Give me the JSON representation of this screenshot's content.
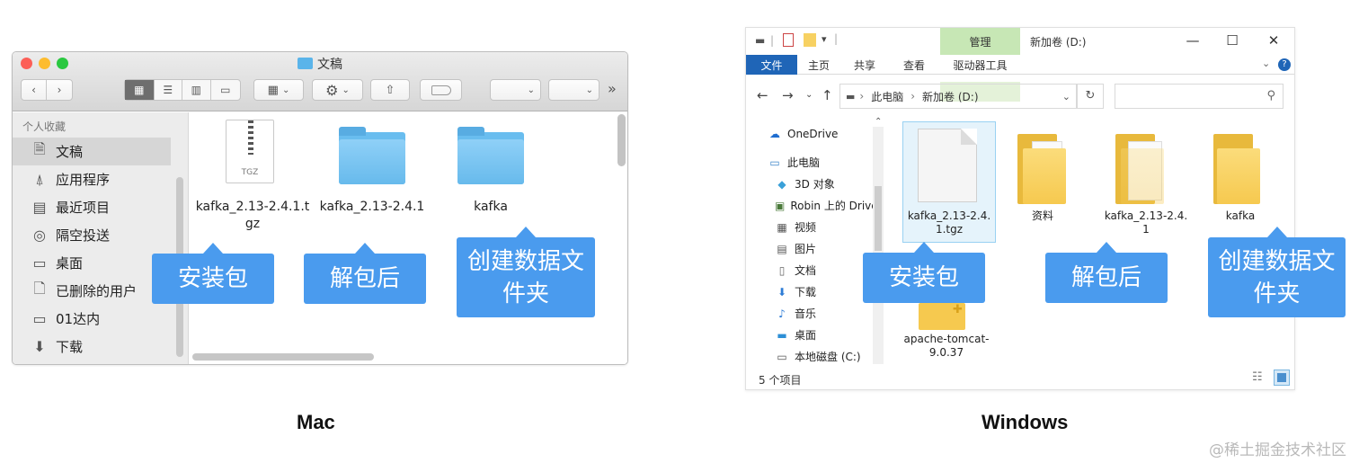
{
  "mac": {
    "window_title": "文稿",
    "sidebar_section": "个人收藏",
    "sidebar_items": [
      {
        "label": "文稿",
        "icon": "documents-icon"
      },
      {
        "label": "应用程序",
        "icon": "applications-icon"
      },
      {
        "label": "最近项目",
        "icon": "recents-icon"
      },
      {
        "label": "隔空投送",
        "icon": "airdrop-icon"
      },
      {
        "label": "桌面",
        "icon": "desktop-icon"
      },
      {
        "label": "已删除的用户",
        "icon": "document-icon"
      },
      {
        "label": "01达内",
        "icon": "folder-icon"
      },
      {
        "label": "下载",
        "icon": "download-icon"
      }
    ],
    "files": [
      {
        "name_line1": "kafka_2.13-2.4.1.t",
        "name_line2": "gz",
        "type": "archive",
        "badge": "TGZ"
      },
      {
        "name_line1": "kafka_2.13-2.4.1",
        "name_line2": "",
        "type": "folder"
      },
      {
        "name_line1": "kafka",
        "name_line2": "",
        "type": "folder"
      }
    ],
    "caption": "Mac"
  },
  "windows": {
    "ribbon": {
      "manage": "管理",
      "drive_title": "新加卷 (D:)",
      "tabs": [
        "文件",
        "主页",
        "共享",
        "查看",
        "驱动器工具"
      ]
    },
    "address": {
      "crumb1": "此电脑",
      "crumb2": "新加卷 (D:)",
      "separator": "›"
    },
    "nav_items": [
      {
        "label": "OneDrive",
        "icon": "onedrive-icon"
      },
      {
        "label": "此电脑",
        "icon": "this-pc-icon"
      },
      {
        "label": "3D 对象",
        "icon": "3d-objects-icon"
      },
      {
        "label": "Robin 上的 Drive",
        "icon": "network-drive-icon"
      },
      {
        "label": "视频",
        "icon": "videos-icon"
      },
      {
        "label": "图片",
        "icon": "pictures-icon"
      },
      {
        "label": "文档",
        "icon": "documents-icon"
      },
      {
        "label": "下载",
        "icon": "downloads-icon"
      },
      {
        "label": "音乐",
        "icon": "music-icon"
      },
      {
        "label": "桌面",
        "icon": "desktop-icon"
      },
      {
        "label": "本地磁盘 (C:)",
        "icon": "local-disk-icon"
      }
    ],
    "files": [
      {
        "name_line1": "kafka_2.13-2.4.",
        "name_line2": "1.tgz",
        "type": "file"
      },
      {
        "name_line1": "资料",
        "name_line2": "",
        "type": "folder"
      },
      {
        "name_line1": "kafka_2.13-2.4.",
        "name_line2": "1",
        "type": "folder"
      },
      {
        "name_line1": "kafka",
        "name_line2": "",
        "type": "folder"
      },
      {
        "name_line1": "apache-tomcat-",
        "name_line2": "9.0.37",
        "type": "folder"
      }
    ],
    "status": "5 个项目",
    "caption": "Windows"
  },
  "callouts": {
    "installer": "安装包",
    "extracted": "解包后",
    "create_line1": "创建数据文",
    "create_line2": "件夹"
  },
  "watermark": "@稀土掘金技术社区",
  "colors": {
    "callout": "#4a9bee",
    "win_file_tab": "#1f65b7",
    "win_manage": "#c7e7b5",
    "mac_folder": "#69bdef",
    "win_folder": "#f6c94f"
  }
}
